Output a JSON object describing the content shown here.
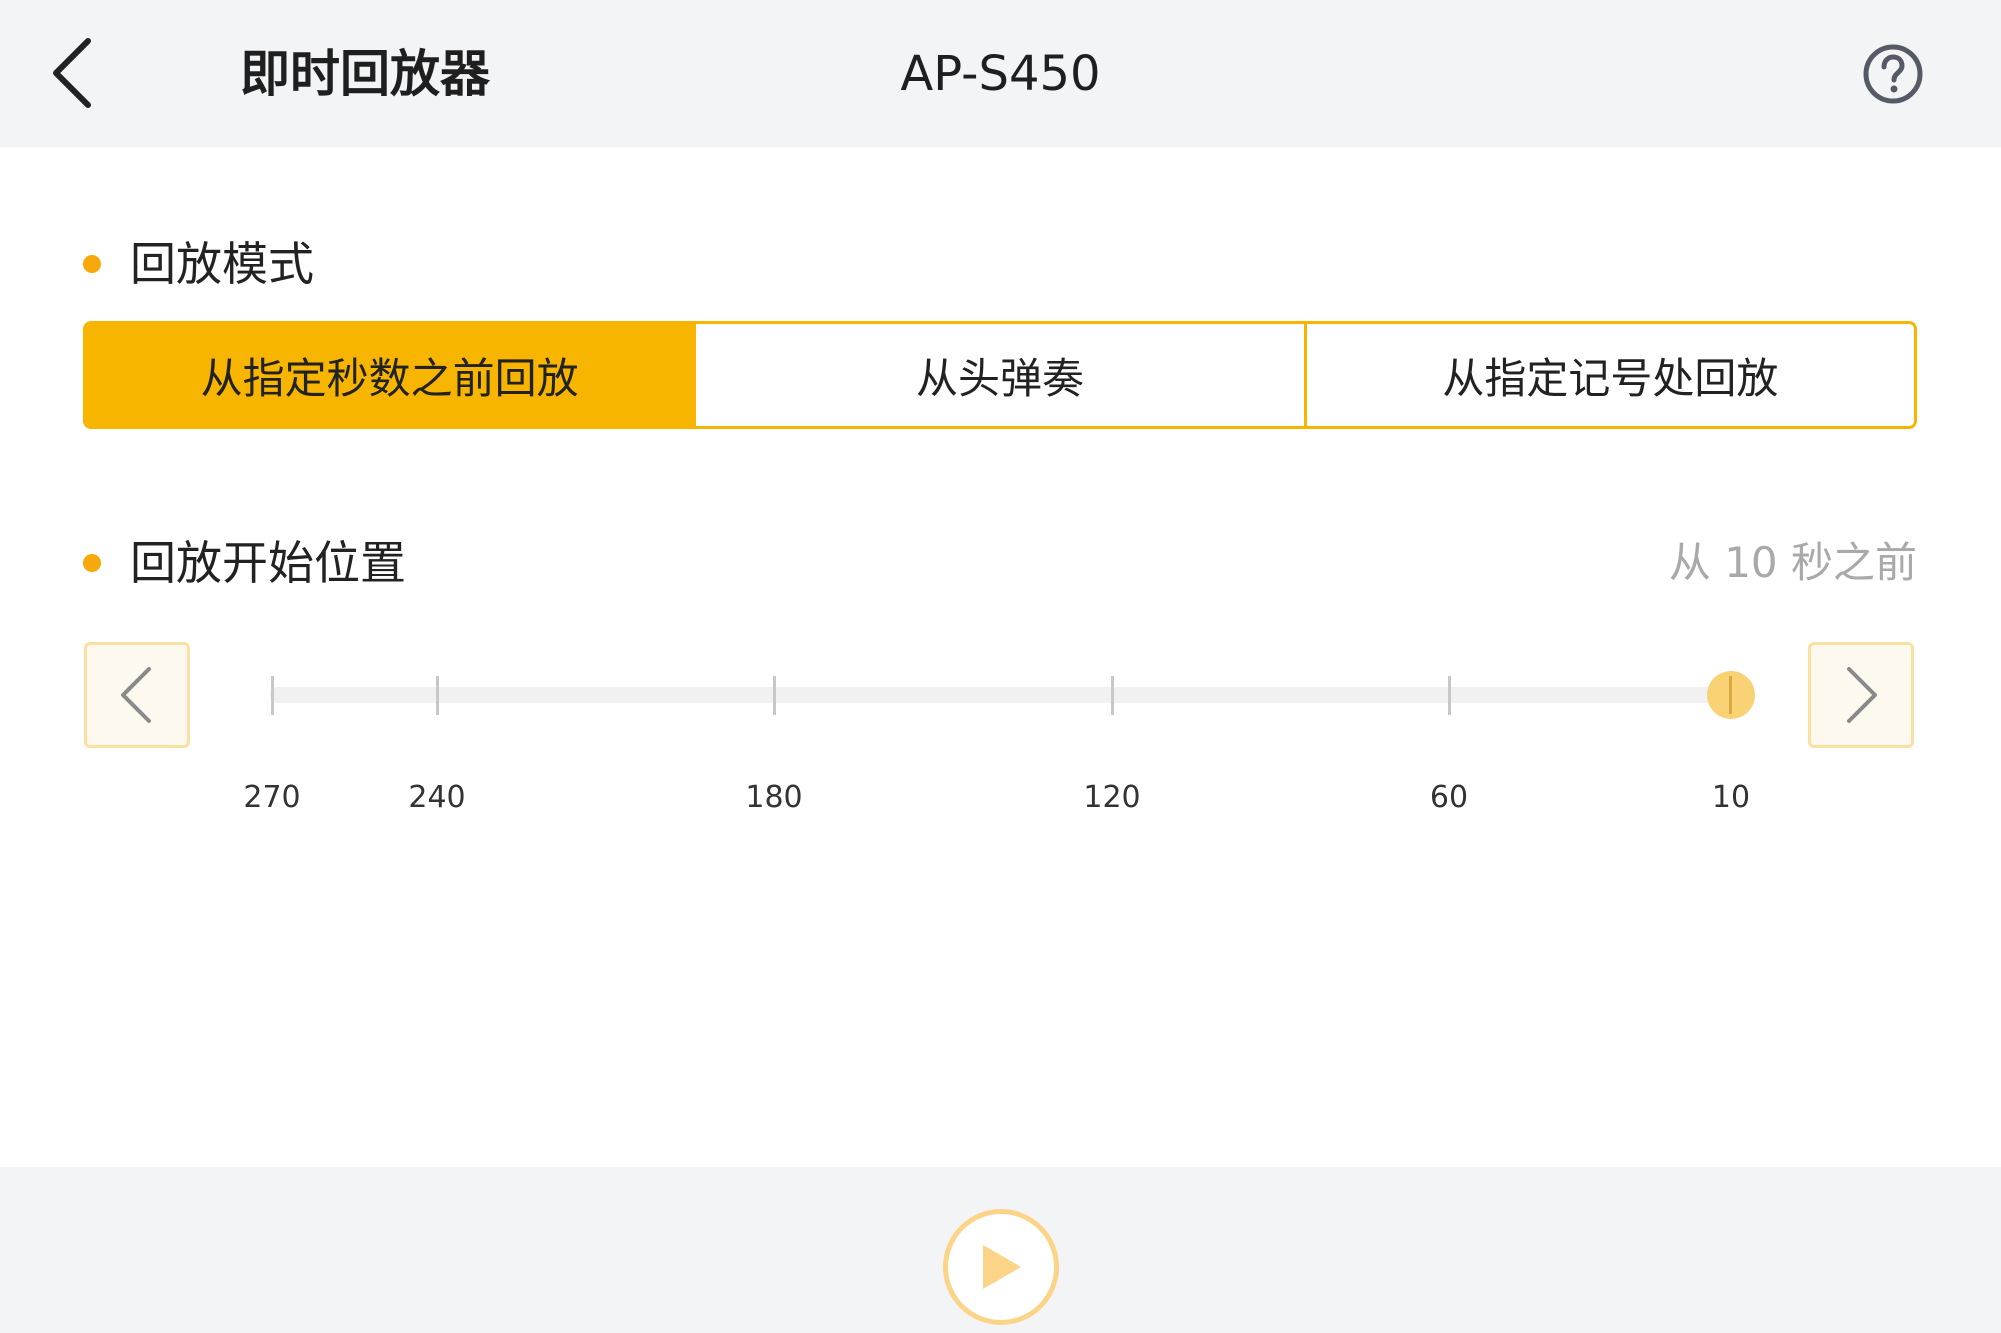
{
  "header": {
    "title": "即时回放器",
    "device": "AP-S450"
  },
  "icons": {
    "back": "chevron-left-icon",
    "help": "question-circle-icon",
    "step_prev": "chevron-left-icon",
    "step_next": "chevron-right-icon",
    "play": "play-icon"
  },
  "mode_section": {
    "title": "回放模式",
    "options": [
      {
        "label": "从指定秒数之前回放",
        "selected": true
      },
      {
        "label": "从头弹奏",
        "selected": false
      },
      {
        "label": "从指定记号处回放",
        "selected": false
      }
    ]
  },
  "position_section": {
    "title": "回放开始位置",
    "value": "从 10 秒之前",
    "slider": {
      "ticks": [
        "270",
        "240",
        "180",
        "120",
        "60",
        "10"
      ],
      "selected": "10"
    }
  },
  "colors": {
    "accent": "#f7b500",
    "dot": "#f7a90a",
    "header_bg": "#f3f4f6",
    "muted_text": "#a9a9a9"
  }
}
